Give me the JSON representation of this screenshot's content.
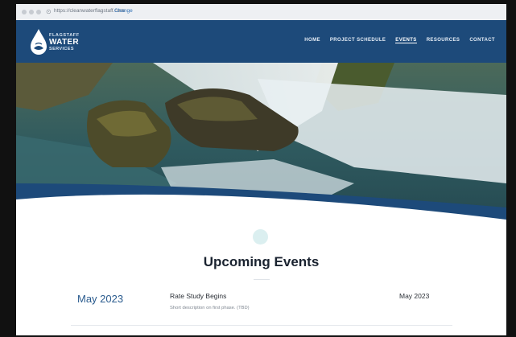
{
  "browser": {
    "url": "https://cleanwaterflagstaff.com",
    "change_label": "Change"
  },
  "logo": {
    "line1": "FLAGSTAFF",
    "line2": "WATER",
    "line3": "SERVICES"
  },
  "nav": {
    "items": [
      {
        "label": "HOME",
        "active": false
      },
      {
        "label": "PROJECT SCHEDULE",
        "active": false
      },
      {
        "label": "EVENTS",
        "active": true
      },
      {
        "label": "RESOURCES",
        "active": false
      },
      {
        "label": "CONTACT",
        "active": false
      }
    ]
  },
  "section": {
    "title": "Upcoming Events"
  },
  "events": [
    {
      "date": "May 2023",
      "title": "Rate Study Begins",
      "description": "Short description on first phase. (TBD)",
      "right_date": "May 2023"
    }
  ],
  "colors": {
    "brand_blue": "#1d4a7a",
    "date_blue": "#2a5b8e"
  }
}
